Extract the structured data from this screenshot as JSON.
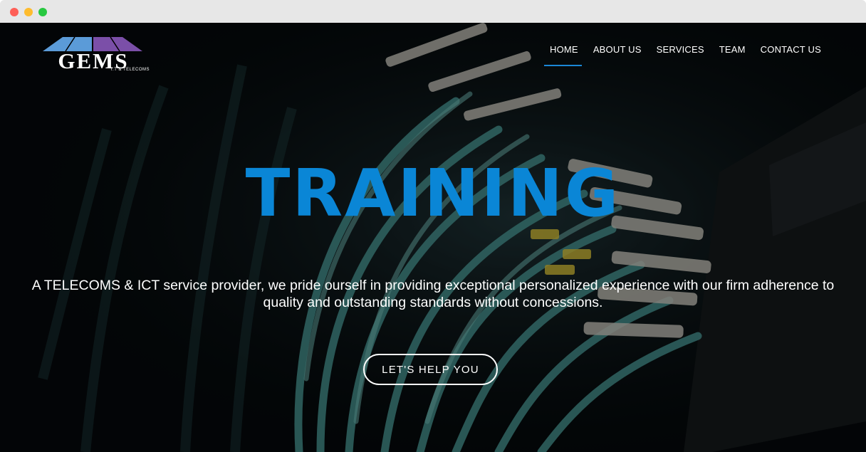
{
  "window": {
    "controls": [
      "close",
      "minimize",
      "maximize"
    ]
  },
  "logo": {
    "word": "GEMS",
    "sub": "I.T & TELECOMS"
  },
  "nav": {
    "items": [
      {
        "label": "HOME",
        "active": true
      },
      {
        "label": "ABOUT US"
      },
      {
        "label": "SERVICES"
      },
      {
        "label": "TEAM"
      },
      {
        "label": "CONTACT US"
      }
    ]
  },
  "hero": {
    "title": "TRAINING",
    "text": "A TELECOMS & ICT service provider, we pride ourself in providing exceptional personalized experience with our firm adherence to quality and outstanding standards without concessions.",
    "cta": "LET'S HELP YOU",
    "background": "fiber-optic-cables-image"
  },
  "colors": {
    "accent": "#0a86d6",
    "hero_bg": "#05090b",
    "logo_left": "#5b9bd8",
    "logo_right": "#7b4fa8"
  }
}
